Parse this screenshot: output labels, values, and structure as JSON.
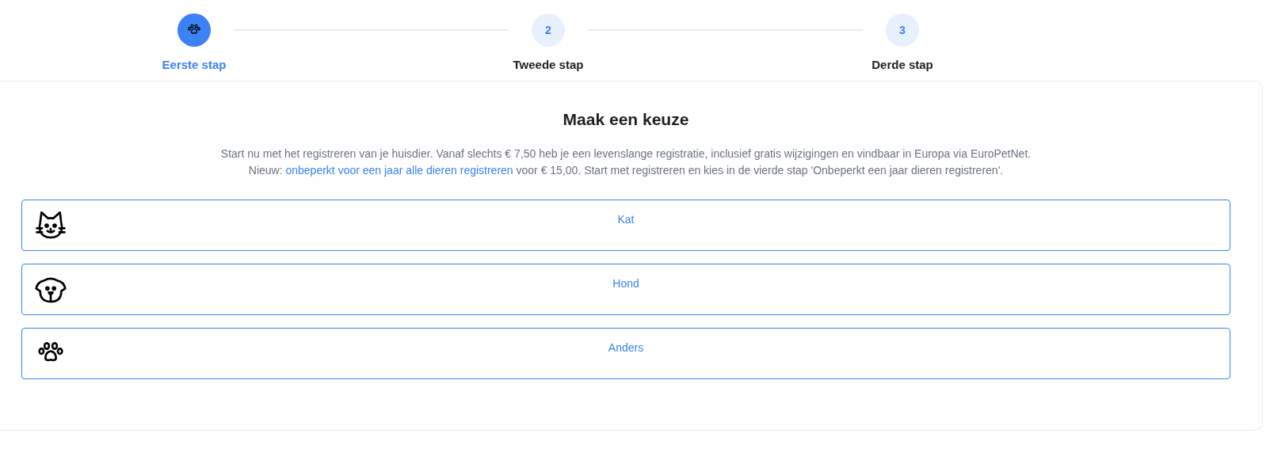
{
  "steps": [
    {
      "label": "Eerste stap",
      "selected": true
    },
    {
      "label": "Tweede stap",
      "number": "2",
      "selected": false
    },
    {
      "label": "Derde stap",
      "number": "3",
      "selected": false
    }
  ],
  "card": {
    "title": "Maak een keuze",
    "intro": "Start nu met het registreren van je huisdier. Vanaf slechts € 7,50 heb je een levenslange registratie, inclusief gratis wijzigingen en vindbaar in Europa via EuroPetNet.",
    "news": {
      "prefix": "Nieuw:",
      "link": "onbeperkt voor een jaar alle dieren registreren",
      "suffix": "voor € 15,00. Start met registreren en kies in de vierde stap 'Onbeperkt een jaar dieren registreren'."
    },
    "options": [
      {
        "kind": "cat",
        "label": "Kat"
      },
      {
        "kind": "dog",
        "label": "Hond"
      },
      {
        "kind": "other",
        "label": "Anders"
      }
    ]
  }
}
